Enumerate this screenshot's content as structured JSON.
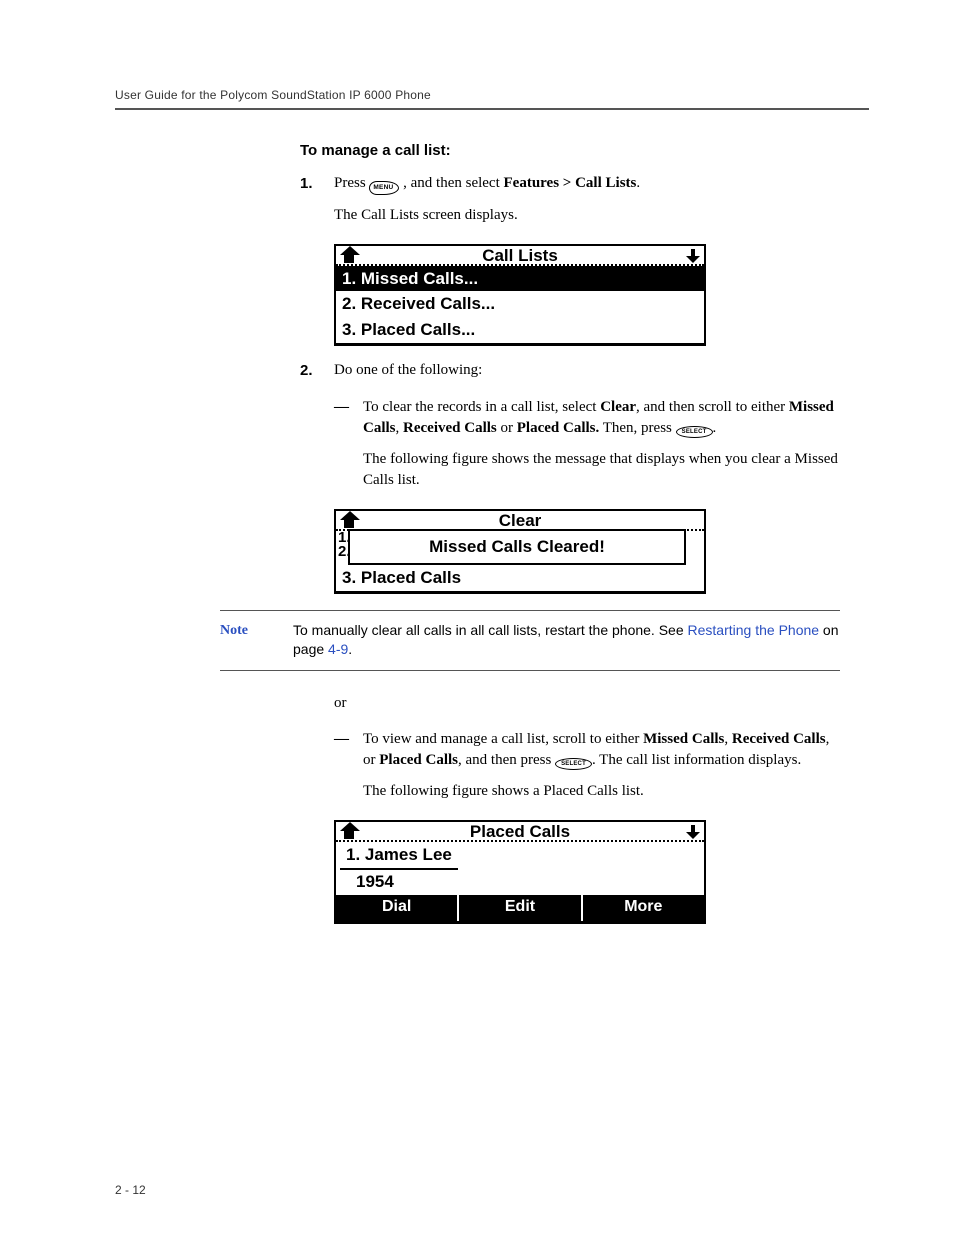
{
  "header": {
    "running": "User Guide for the Polycom SoundStation IP 6000 Phone"
  },
  "heading": "To manage a call list:",
  "step1": {
    "num": "1.",
    "text_before": "Press ",
    "menu_key": "MENU",
    "text_mid": ", and then select ",
    "bold_path": "Features > Call Lists",
    "text_after": ".",
    "para2": "The Call Lists screen displays."
  },
  "lcd1": {
    "title": "Call Lists",
    "row1": "1. Missed Calls...",
    "row2": "2. Received Calls...",
    "row3": "3. Placed Calls..."
  },
  "step2": {
    "num": "2.",
    "lead": "Do one of the following:"
  },
  "sub1": {
    "dash": "—",
    "t1": "To clear the records in a call list, select ",
    "b1": "Clear",
    "t2": ", and then scroll to either ",
    "b2": "Missed Calls",
    "t3": ", ",
    "b3": "Received Calls",
    "t4": " or ",
    "b4": "Placed Calls.",
    "t5": " Then, press ",
    "select_key": "SELECT",
    "t6": ".",
    "para2": "The following figure shows the message that displays when you clear a Missed Calls list."
  },
  "lcd2": {
    "title": "Clear",
    "leftnum1": "1.",
    "leftnum2": "2.",
    "popup": "Missed Calls Cleared!",
    "row3": "3. Placed Calls"
  },
  "note": {
    "label": "Note",
    "t1": "To manually clear all calls in all call lists, restart the phone. See ",
    "link": "Restarting the Phone",
    "t2": " on page ",
    "pageref": "4-9",
    "t3": "."
  },
  "or_text": "or",
  "sub2": {
    "dash": "—",
    "t1": "To view and manage a call list, scroll to either ",
    "b1": "Missed Calls",
    "t2": ", ",
    "b2": "Received Calls",
    "t3": ", or ",
    "b3": "Placed Calls",
    "t4": ", and then press ",
    "select_key": "SELECT",
    "t5": ". The call list information displays.",
    "para2": "The following figure shows a Placed Calls list."
  },
  "lcd3": {
    "title": "Placed Calls",
    "entry_name": "1. James Lee",
    "entry_num": "1954",
    "sk1": "Dial",
    "sk2": "Edit",
    "sk3": "More"
  },
  "footer": {
    "pagenum": "2 - 12"
  }
}
